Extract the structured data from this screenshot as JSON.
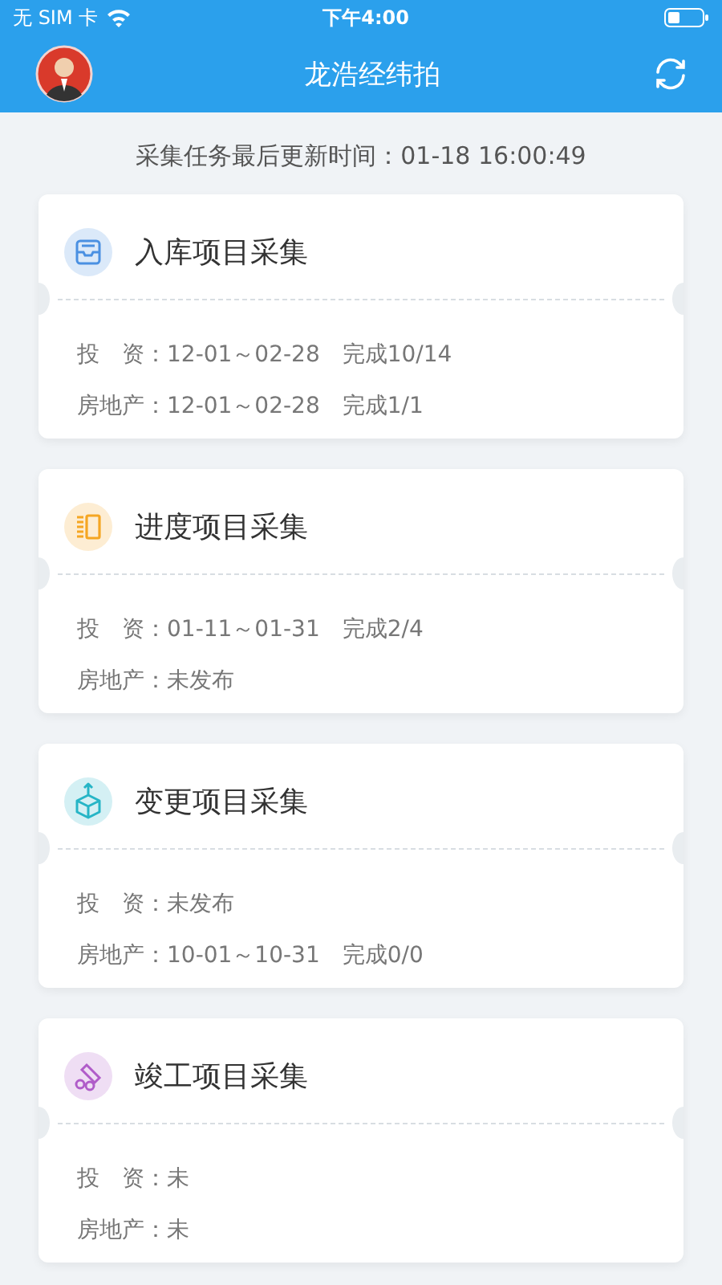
{
  "status_bar": {
    "carrier": "无 SIM 卡",
    "time": "下午4:00"
  },
  "header": {
    "title": "龙浩经纬拍"
  },
  "update_info": "采集任务最后更新时间：01-18 16:00:49",
  "cards": [
    {
      "title": "入库项目采集",
      "kind": "inbox",
      "color": "#4a90e2",
      "lines": [
        "投　资：12-01～02-28　完成10/14",
        "房地产：12-01～02-28　完成1/1"
      ]
    },
    {
      "title": "进度项目采集",
      "kind": "progress",
      "color": "#f5a623",
      "lines": [
        "投　资：01-11～01-31　完成2/4",
        "房地产：未发布"
      ]
    },
    {
      "title": "变更项目采集",
      "kind": "box",
      "color": "#26b5c6",
      "lines": [
        "投　资：未发布",
        "房地产：10-01～10-31　完成0/0"
      ]
    },
    {
      "title": "竣工项目采集",
      "kind": "tools",
      "color": "#b05cc9",
      "lines": [
        "投　资：未",
        "房地产：未"
      ]
    }
  ]
}
